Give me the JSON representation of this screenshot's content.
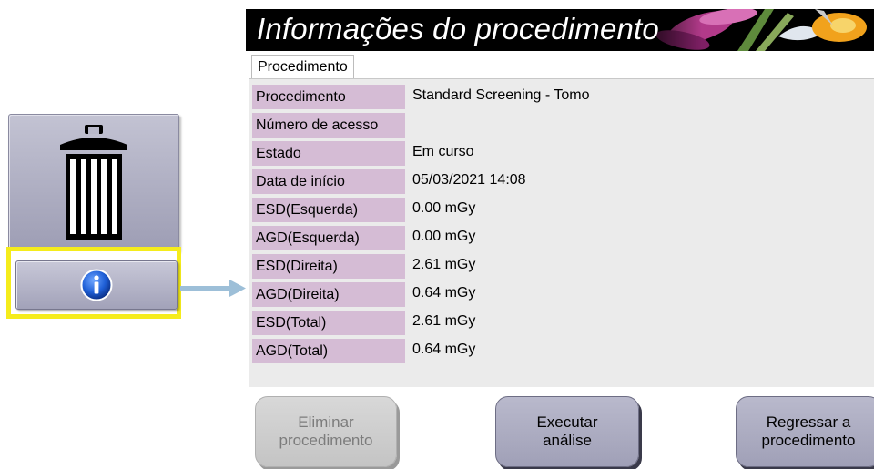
{
  "dialog": {
    "title": "Informações do procedimento",
    "tab_label": "Procedimento",
    "rows": [
      {
        "label": "Procedimento",
        "value": "Standard Screening - Tomo"
      },
      {
        "label": "Número de acesso",
        "value": ""
      },
      {
        "label": "Estado",
        "value": "Em curso"
      },
      {
        "label": "Data de início",
        "value": "05/03/2021 14:08"
      },
      {
        "label": "ESD(Esquerda)",
        "value": "0.00 mGy"
      },
      {
        "label": "AGD(Esquerda)",
        "value": "0.00 mGy"
      },
      {
        "label": "ESD(Direita)",
        "value": "2.61 mGy"
      },
      {
        "label": "AGD(Direita)",
        "value": "0.64 mGy"
      },
      {
        "label": "ESD(Total)",
        "value": "2.61 mGy"
      },
      {
        "label": "AGD(Total)",
        "value": "0.64 mGy"
      }
    ],
    "buttons": {
      "delete": "Eliminar\nprocedimento",
      "analysis": "Executar\nanálise",
      "return": "Regressar a\nprocedimento"
    }
  },
  "side_panel": {
    "trash_icon": "trash-can-icon",
    "info_icon": "info-icon",
    "highlight_color": "#f5ec1c"
  },
  "colors": {
    "label_bg": "#d5bcd5",
    "panel_bg": "#ebebeb",
    "button_bg": "#a8a8bf",
    "arrow": "#9dbfd8"
  }
}
